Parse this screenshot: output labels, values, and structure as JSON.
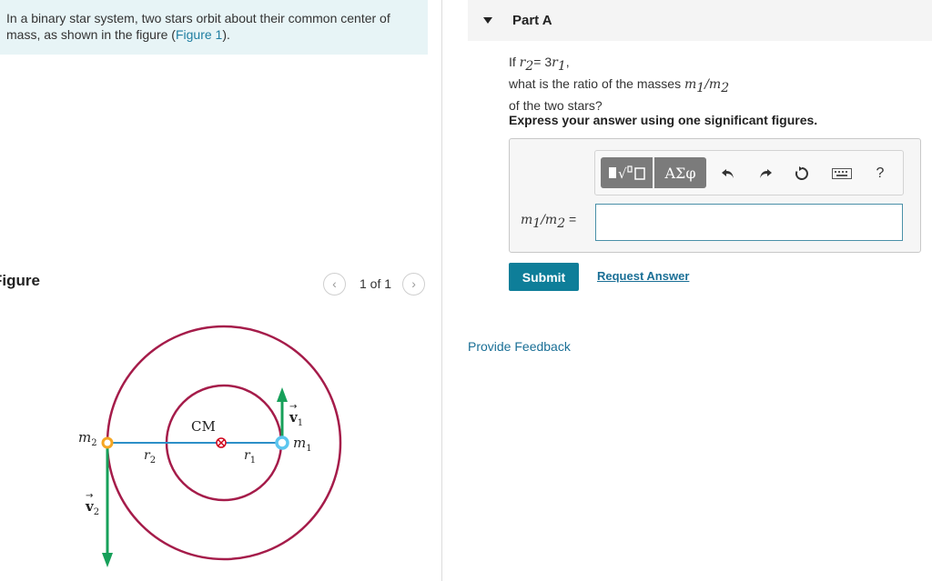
{
  "problem": {
    "intro_line1": "In a binary star system, two stars orbit about their common center of",
    "intro_line2_prefix": "mass, as shown in the figure (",
    "figure_link": "Figure 1",
    "intro_line2_suffix": ")."
  },
  "figure": {
    "heading": "Figure",
    "page_indicator": "1 of 1",
    "prev_icon": "chevron-left-icon",
    "next_icon": "chevron-right-icon",
    "labels": {
      "cm": "CM",
      "m1": "m",
      "m1_sub": "1",
      "m2": "m",
      "m2_sub": "2",
      "r1": "r",
      "r1_sub": "1",
      "r2": "r",
      "r2_sub": "2",
      "v1": "v",
      "v1_sub": "1",
      "v2": "v",
      "v2_sub": "2"
    },
    "colors": {
      "orbit": "#a51c4a",
      "separation_line": "#2c8fc8",
      "velocity_arrow": "#17a05a",
      "star1": "#5cc6ef",
      "star2": "#f5a623",
      "cm_marker": "#d0021b"
    }
  },
  "part_a": {
    "title": "Part A",
    "q_if": "If ",
    "q_r2": "r",
    "q_r2_sub": "2",
    "q_eq": "= 3",
    "q_r1": "r",
    "q_r1_sub": "1",
    "q_comma": ",",
    "q_line2": "what is the ratio of the masses ",
    "q_m1": "m",
    "q_m1_sub": "1",
    "q_slash": "/",
    "q_m2": "m",
    "q_m2_sub": "2",
    "q_line3": "of the two stars?",
    "instruction": "Express your answer using one significant figures.",
    "toolbar": {
      "templates_icon": "radical-template-icon",
      "greek_label": "ΑΣφ",
      "undo_icon": "undo-icon",
      "redo_icon": "redo-icon",
      "reset_icon": "reset-icon",
      "keyboard_icon": "keyboard-icon",
      "help_label": "?"
    },
    "answer_label_m1": "m",
    "answer_label_m1_sub": "1",
    "answer_label_slash": "/",
    "answer_label_m2": "m",
    "answer_label_m2_sub": "2",
    "answer_label_eq": " =",
    "answer_value": "",
    "submit_label": "Submit",
    "request_label": "Request Answer"
  },
  "feedback_label": "Provide Feedback"
}
